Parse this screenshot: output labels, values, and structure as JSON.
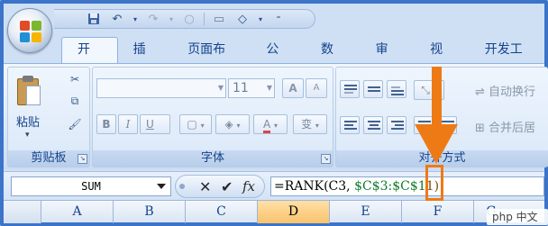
{
  "tabs": [
    {
      "label": "开始",
      "active": true
    },
    {
      "label": "插入",
      "active": false
    },
    {
      "label": "页面布局",
      "active": false
    },
    {
      "label": "公式",
      "active": false
    },
    {
      "label": "数据",
      "active": false
    },
    {
      "label": "审阅",
      "active": false
    },
    {
      "label": "视图",
      "active": false
    },
    {
      "label": "开发工具",
      "active": false
    }
  ],
  "quick_access": {
    "icons": [
      "save-icon",
      "undo-icon",
      "redo-icon",
      "circle-icon",
      "eraser-icon",
      "customize-icon"
    ]
  },
  "ribbon": {
    "clipboard": {
      "paste_label": "粘贴",
      "group_label": "剪贴板"
    },
    "font": {
      "font_size": "11",
      "bold": "B",
      "italic": "I",
      "underline": "U",
      "phonetic": "变",
      "grow": "A",
      "shrink": "A",
      "font_color": "A",
      "group_label": "字体"
    },
    "alignment": {
      "wrap_text": "自动换行",
      "merge_center": "合并后居",
      "group_label": "对齐方式"
    }
  },
  "formula_bar": {
    "name_box": "SUM",
    "fx_label": "fx",
    "formula_prefix": "=RANK(C3, ",
    "formula_ref": "$C$3:$C$1",
    "formula_tail": "1)"
  },
  "columns": [
    {
      "label": "A",
      "selected": false
    },
    {
      "label": "B",
      "selected": false
    },
    {
      "label": "C",
      "selected": false
    },
    {
      "label": "D",
      "selected": true
    },
    {
      "label": "E",
      "selected": false
    },
    {
      "label": "F",
      "selected": false
    },
    {
      "label": "G",
      "selected": false
    }
  ],
  "watermark": "php 中文网",
  "colors": {
    "accent": "#3b74c9",
    "annotation": "#ee7a16",
    "selected_column": "#f9c26d"
  }
}
